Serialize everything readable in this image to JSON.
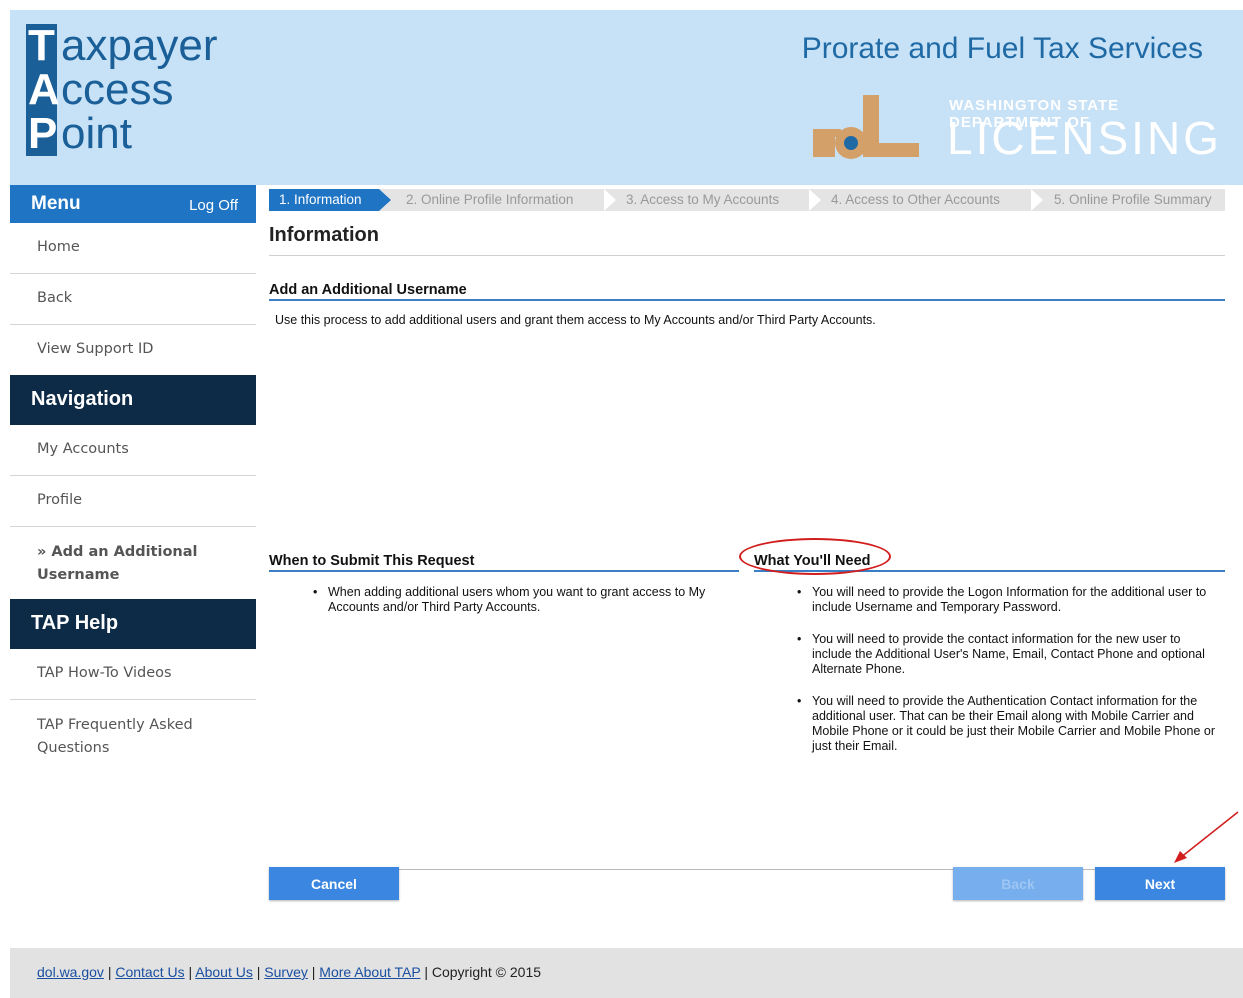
{
  "header": {
    "logo_lines": [
      {
        "cap": "T",
        "rest": "axpayer"
      },
      {
        "cap": "A",
        "rest": "ccess"
      },
      {
        "cap": "P",
        "rest": "oint"
      }
    ],
    "title": "Prorate and Fuel Tax Services",
    "dol_small": "WASHINGTON STATE DEPARTMENT OF",
    "dol_big": "LICENSING"
  },
  "sidebar": {
    "menu_label": "Menu",
    "logoff_label": "Log Off",
    "menu_items": [
      "Home",
      "Back",
      "View Support ID"
    ],
    "navigation_label": "Navigation",
    "nav_items": [
      "My Accounts",
      "Profile"
    ],
    "active_item": "» Add an Additional Username",
    "help_label": "TAP Help",
    "help_items": [
      "TAP How-To Videos",
      "TAP Frequently Asked Questions"
    ]
  },
  "steps": [
    "1. Information",
    "2. Online Profile Information",
    "3. Access to My Accounts",
    "4. Access to Other Accounts",
    "5. Online Profile Summary"
  ],
  "main": {
    "page_title": "Information",
    "section_title": "Add an Additional Username",
    "intro": "Use this process to add additional users and grant them access to My Accounts and/or Third Party Accounts.",
    "when_title": "When to Submit This Request",
    "when_items": [
      "When adding additional users whom you want to grant access to My Accounts and/or Third Party Accounts."
    ],
    "need_title": "What You'll Need",
    "need_items": [
      "You will need to provide the Logon Information for the additional user to include Username and Temporary Password.",
      "You will need to provide the contact information for the new user to include the Additional User's Name, Email, Contact Phone and optional Alternate Phone.",
      "You will need to provide the Authentication Contact information for the additional user. That can be their Email along with Mobile Carrier and Mobile Phone or it could be just their Mobile Carrier and Mobile Phone or just their Email."
    ]
  },
  "buttons": {
    "cancel": "Cancel",
    "back": "Back",
    "next": "Next"
  },
  "footer": {
    "links": [
      "dol.wa.gov",
      "Contact Us",
      "About Us",
      "Survey",
      "More About TAP"
    ],
    "copyright": "Copyright © 2015"
  },
  "colors": {
    "header_bg": "#c7e1f6",
    "accent_blue": "#1f74c4",
    "nav_dark": "#0d2a47",
    "annotation_red": "#d21d1d"
  }
}
